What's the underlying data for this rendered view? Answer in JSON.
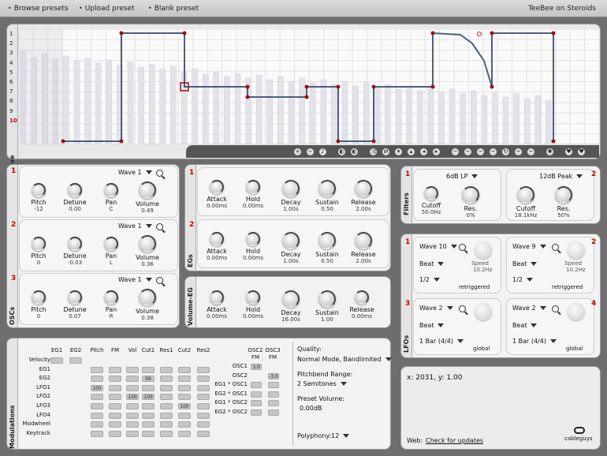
{
  "menu": {
    "browse": "Browse presets",
    "upload": "Upload preset",
    "blank": "Blank preset",
    "title": "TeeBee on Steroids"
  },
  "wave": {
    "label": "Wave",
    "rows": [
      "1",
      "2",
      "3",
      "4",
      "5",
      "6",
      "7",
      "8",
      "9",
      "10"
    ],
    "toolbar": [
      "zoom-in-icon",
      "zoom-out-icon",
      "music-icon",
      "half-circle-icon",
      "half-circle-icon",
      "shuffle-icon",
      "swap-icon",
      "arrow-down-icon",
      "arrow-up-icon",
      "arrow-left-icon",
      "arrow-right-icon",
      "line-icon",
      "minus-icon",
      "wave-icon",
      "wave-icon",
      "loop-icon",
      "wave-icon",
      "wave-icon",
      "star-icon",
      "heart-down-icon",
      "heart-up-icon"
    ]
  },
  "oscs": {
    "label": "OSCs",
    "items": [
      {
        "num": "1",
        "wave": "Wave 1",
        "pitch": "-12",
        "detune": "0.00",
        "pan": "C",
        "volume": "0.49"
      },
      {
        "num": "2",
        "wave": "Wave 1",
        "pitch": "0",
        "detune": "-0.03",
        "pan": "L",
        "volume": "0.36"
      },
      {
        "num": "3",
        "wave": "Wave 1",
        "pitch": "0",
        "detune": "0.07",
        "pan": "R",
        "volume": "0.38"
      }
    ],
    "labels": {
      "pitch": "Pitch",
      "detune": "Detune",
      "pan": "Pan",
      "volume": "Volume"
    }
  },
  "egs": {
    "label": "EGs",
    "labels": {
      "attack": "Attack",
      "hold": "Hold",
      "decay": "Decay",
      "sustain": "Sustain",
      "release": "Release"
    },
    "items": [
      {
        "num": "1",
        "attack": "0.00ms",
        "hold": "0.00ms",
        "decay": "1.00s",
        "sustain": "0.50",
        "release": "2.00s"
      },
      {
        "num": "2",
        "attack": "0.00ms",
        "hold": "0.00ms",
        "decay": "1.00s",
        "sustain": "0.50",
        "release": "2.00s"
      }
    ]
  },
  "volume_eg": {
    "label": "Volume-EG",
    "attack": "0.00ms",
    "hold": "0.00ms",
    "decay": "16.00s",
    "sustain": "1.00",
    "release": "0.00ms"
  },
  "filters": {
    "label": "Filters",
    "items": [
      {
        "num": "1",
        "type": "6dB LP",
        "cutoff": "50.0Hz",
        "res": "0%"
      },
      {
        "num": "2",
        "type": "12dB Peak",
        "cutoff": "18.1kHz",
        "res": "50%"
      }
    ],
    "labels": {
      "cutoff": "Cutoff",
      "res": "Res."
    }
  },
  "lfos": {
    "label": "LFOs",
    "speed_label": "Speed",
    "items": [
      {
        "num": "1",
        "wave": "Wave 10",
        "mode": "Beat",
        "rate": "1/2",
        "speed": "10.2Hz",
        "trigger": "retriggered"
      },
      {
        "num": "2",
        "wave": "Wave 9",
        "mode": "Beat",
        "rate": "1/2",
        "speed": "10.2Hz",
        "trigger": "retriggered"
      },
      {
        "num": "3",
        "wave": "Wave 2",
        "mode": "Beat",
        "rate": "1 Bar (4/4)",
        "speed": "",
        "trigger": "global"
      },
      {
        "num": "4",
        "wave": "Wave 2",
        "mode": "Beat",
        "rate": "1 Bar (4/4)",
        "speed": "",
        "trigger": "global"
      }
    ]
  },
  "mods": {
    "label": "Modulations",
    "cols": [
      "EG1",
      "EG2",
      "Pitch",
      "FM",
      "Vol",
      "Cut1",
      "Res1",
      "Cut2",
      "Res2"
    ],
    "rows": [
      "Velocity",
      "EG1",
      "EG2",
      "LFO1",
      "LFO2",
      "LFO3",
      "LFO4",
      "Modwheel",
      "Keytrack"
    ],
    "values": [
      {
        "r": 2,
        "c": 5,
        "v": "99"
      },
      {
        "r": 3,
        "c": 2,
        "v": "100"
      },
      {
        "r": 4,
        "c": 4,
        "v": "100"
      },
      {
        "r": 4,
        "c": 5,
        "v": "100"
      },
      {
        "r": 5,
        "c": 7,
        "v": "100"
      }
    ],
    "osc_cols_top": [
      "OSC2",
      "OSC3"
    ],
    "osc_cols_sub": [
      "FM",
      "FM"
    ],
    "osc_rows": [
      "OSC1",
      "OSC2",
      "EG1 * OSC1",
      "EG2 * OSC1",
      "EG1 * OSC2",
      "EG2 * OSC2"
    ],
    "osc_vals": [
      {
        "r": 0,
        "c": 0,
        "v": "3.0"
      },
      {
        "r": 1,
        "c": 1,
        "v": "-3.0"
      }
    ]
  },
  "settings": {
    "quality_label": "Quality:",
    "quality": "Normal Mode, Bandlimited",
    "pb_label": "Pitchbend Range:",
    "pb": "2 Semitones",
    "pv_label": "Preset Volume:",
    "pv": "0.00dB",
    "poly_label": "Polyphony:",
    "poly": "12"
  },
  "info": {
    "coords": "x: 2031, y: 1.00",
    "web_label": "Web:",
    "web_link": "Check for updates",
    "brand": "cableguys"
  }
}
